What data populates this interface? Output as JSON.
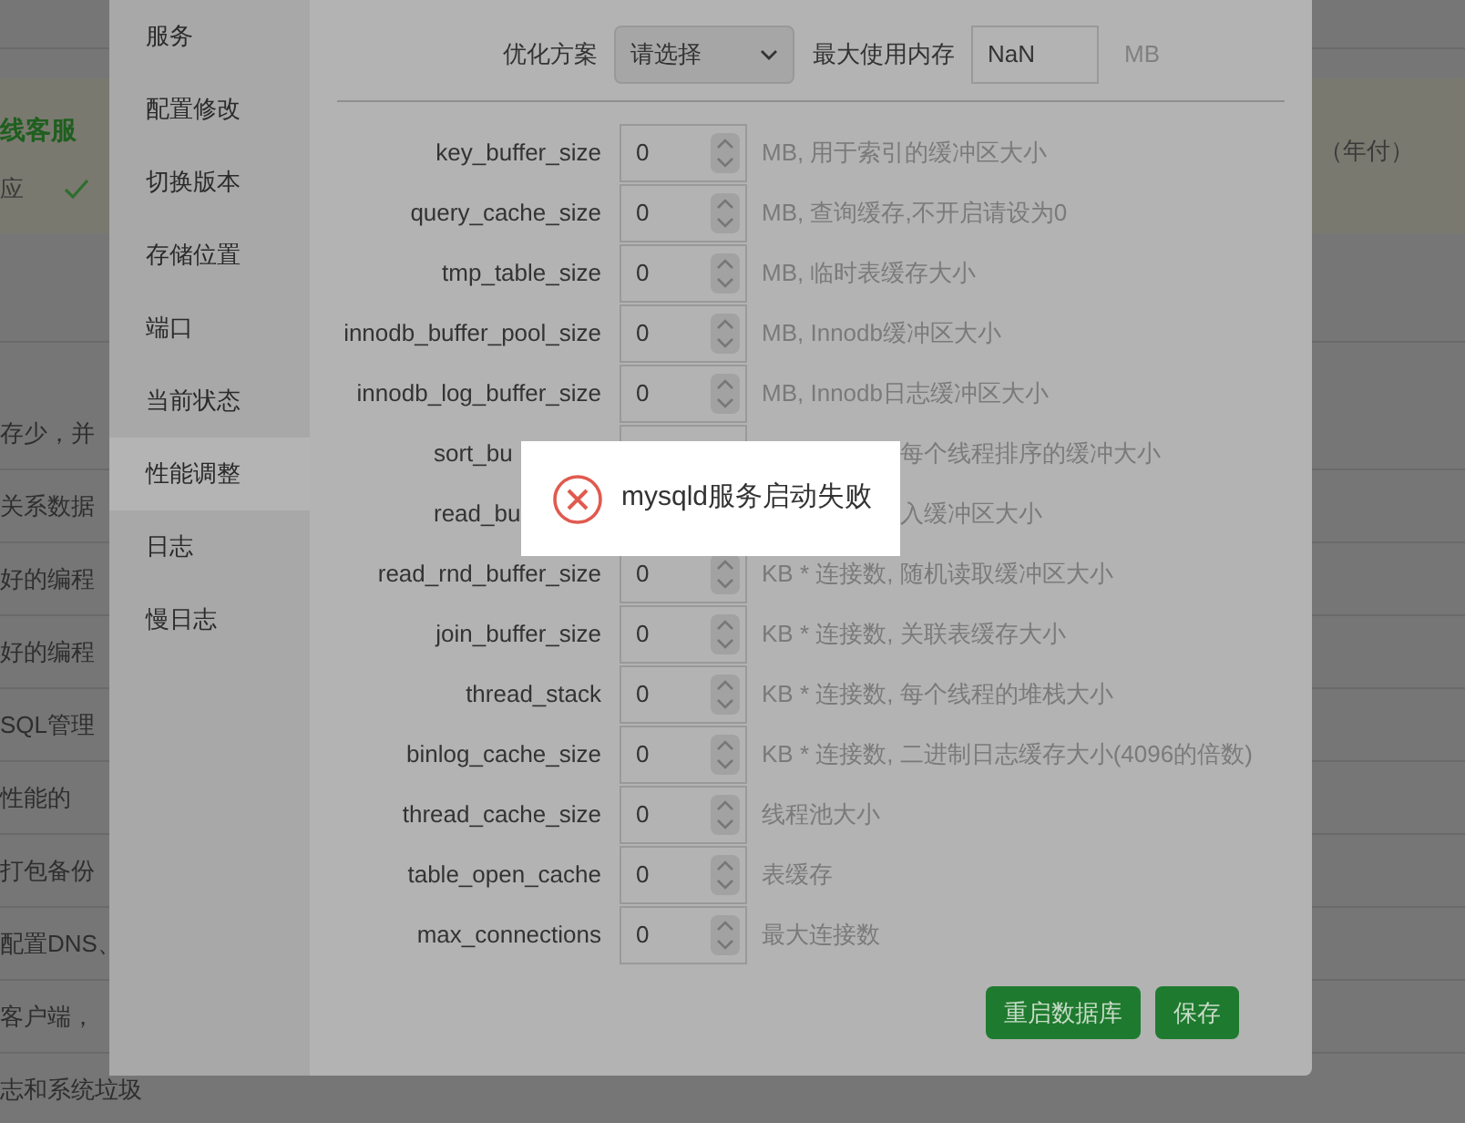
{
  "background": {
    "top_texts": [
      {
        "text": "线客服",
        "kind": "title"
      },
      {
        "text": "应",
        "kind": "check"
      }
    ],
    "right_text": "（年付）",
    "rows": [
      "存少，并",
      "关系数据",
      "好的编程",
      "好的编程",
      "SQL管理",
      "性能的",
      "打包备份",
      "配置DNS、",
      "客户端，",
      "志和系统垃圾"
    ]
  },
  "dialog": {
    "sidebar": [
      {
        "label": "服务",
        "selected": false
      },
      {
        "label": "配置修改",
        "selected": false
      },
      {
        "label": "切换版本",
        "selected": false
      },
      {
        "label": "存储位置",
        "selected": false
      },
      {
        "label": "端口",
        "selected": false
      },
      {
        "label": "当前状态",
        "selected": false
      },
      {
        "label": "性能调整",
        "selected": true
      },
      {
        "label": "日志",
        "selected": false
      },
      {
        "label": "慢日志",
        "selected": false
      }
    ],
    "plan_label": "优化方案",
    "plan_select": "请选择",
    "memory_label": "最大使用内存",
    "memory_value": "NaN",
    "memory_unit": "MB",
    "fields": [
      {
        "kind": "normal",
        "label": "key_buffer_size",
        "value": "0",
        "hint": "MB, 用于索引的缓冲区大小"
      },
      {
        "kind": "normal",
        "label": "query_cache_size",
        "value": "0",
        "hint": "MB, 查询缓存,不开启请设为0"
      },
      {
        "kind": "normal",
        "label": "tmp_table_size",
        "value": "0",
        "hint": "MB, 临时表缓存大小"
      },
      {
        "kind": "normal",
        "label": "innodb_buffer_pool_size",
        "value": "0",
        "hint": "MB, Innodb缓冲区大小"
      },
      {
        "kind": "normal",
        "label": "innodb_log_buffer_size",
        "value": "0",
        "hint": "MB, Innodb日志缓冲区大小"
      },
      {
        "kind": "partial",
        "label": "sort_bu",
        "hint": "每个线程排序的缓冲大小"
      },
      {
        "kind": "covered",
        "label": "read_bu",
        "hint": "入缓冲区大小"
      },
      {
        "kind": "normal",
        "label": "read_rnd_buffer_size",
        "value": "0",
        "hint": "KB * 连接数, 随机读取缓冲区大小"
      },
      {
        "kind": "normal",
        "label": "join_buffer_size",
        "value": "0",
        "hint": "KB * 连接数, 关联表缓存大小"
      },
      {
        "kind": "normal",
        "label": "thread_stack",
        "value": "0",
        "hint": "KB * 连接数, 每个线程的堆栈大小"
      },
      {
        "kind": "normal",
        "label": "binlog_cache_size",
        "value": "0",
        "hint": "KB * 连接数, 二进制日志缓存大小(4096的倍数)"
      },
      {
        "kind": "normal",
        "label": "thread_cache_size",
        "value": "0",
        "hint": "线程池大小"
      },
      {
        "kind": "normal",
        "label": "table_open_cache",
        "value": "0",
        "hint": "表缓存"
      },
      {
        "kind": "normal",
        "label": "max_connections",
        "value": "0",
        "hint": "最大连接数"
      }
    ],
    "buttons": [
      "重启数据库",
      "保存"
    ]
  },
  "toast": {
    "kind": "error",
    "message": "mysqld服务启动失败"
  }
}
